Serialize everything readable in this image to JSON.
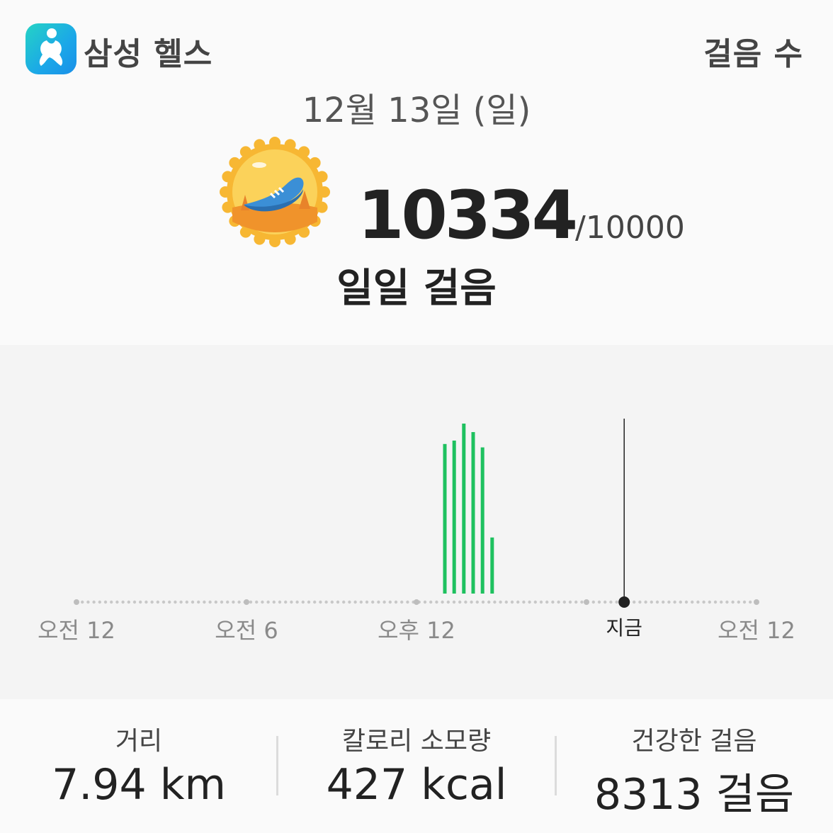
{
  "header": {
    "app_name": "삼성 헬스",
    "section_title": "걸음 수"
  },
  "date": "12월 13일 (일)",
  "summary": {
    "steps": "10334",
    "goal": "/10000",
    "label": "일일 걸음",
    "badge_icon": "running-shoe-badge-icon"
  },
  "chart": {
    "x_labels": [
      "오전 12",
      "오전 6",
      "오후 12",
      "지금",
      "오전 12"
    ],
    "now_label": "지금",
    "bar_color": "#1ec15f"
  },
  "chart_data": {
    "type": "bar",
    "x_unit": "hour of day",
    "x": [
      13.0,
      13.33,
      13.67,
      14.0,
      14.33,
      14.67
    ],
    "values": [
      0.88,
      0.9,
      1.0,
      0.95,
      0.86,
      0.33
    ],
    "value_note": "relative heights only; axis has no printed values",
    "now_hour": 19.33,
    "xlim": [
      0,
      24
    ]
  },
  "stats": [
    {
      "label": "거리",
      "value": "7.94 km"
    },
    {
      "label": "칼로리 소모량",
      "value": "427 kcal"
    },
    {
      "label": "건강한 걸음",
      "value": "8313 걸음"
    }
  ]
}
